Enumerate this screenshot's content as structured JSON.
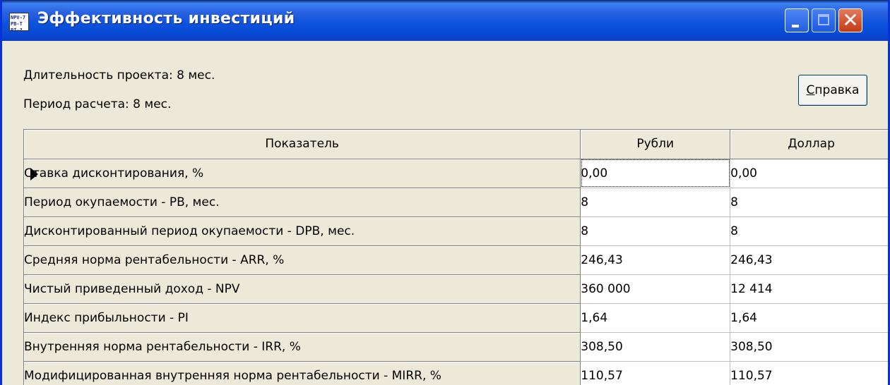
{
  "window": {
    "title": "Эффективность инвестиций",
    "icon_text": "NPV-7\nPB-T\nPI-?"
  },
  "info": {
    "duration": "Длительность проекта: 8 мес.",
    "period": "Период расчета: 8 мес."
  },
  "help_button": {
    "accel": "С",
    "rest": "правка"
  },
  "grid": {
    "columns": [
      "Показатель",
      "Рубли",
      "Доллар"
    ],
    "rows": [
      {
        "name": "Ставка дисконтирования, %",
        "rub": "0,00",
        "usd": "0,00"
      },
      {
        "name": "Период окупаемости - PB, мес.",
        "rub": "8",
        "usd": "8"
      },
      {
        "name": "Дисконтированный период окупаемости - DPB, мес.",
        "rub": "8",
        "usd": "8"
      },
      {
        "name": "Средняя норма рентабельности - ARR, %",
        "rub": "246,43",
        "usd": "246,43"
      },
      {
        "name": "Чистый приведенный доход - NPV",
        "rub": "360 000",
        "usd": "12 414"
      },
      {
        "name": "Индекс прибыльности - PI",
        "rub": "1,64",
        "usd": "1,64"
      },
      {
        "name": "Внутренняя норма рентабельности - IRR, %",
        "rub": "308,50",
        "usd": "308,50"
      },
      {
        "name": "Модифицированная внутренняя норма рентабельности - MIRR, %",
        "rub": "110,57",
        "usd": "110,57"
      }
    ]
  }
}
